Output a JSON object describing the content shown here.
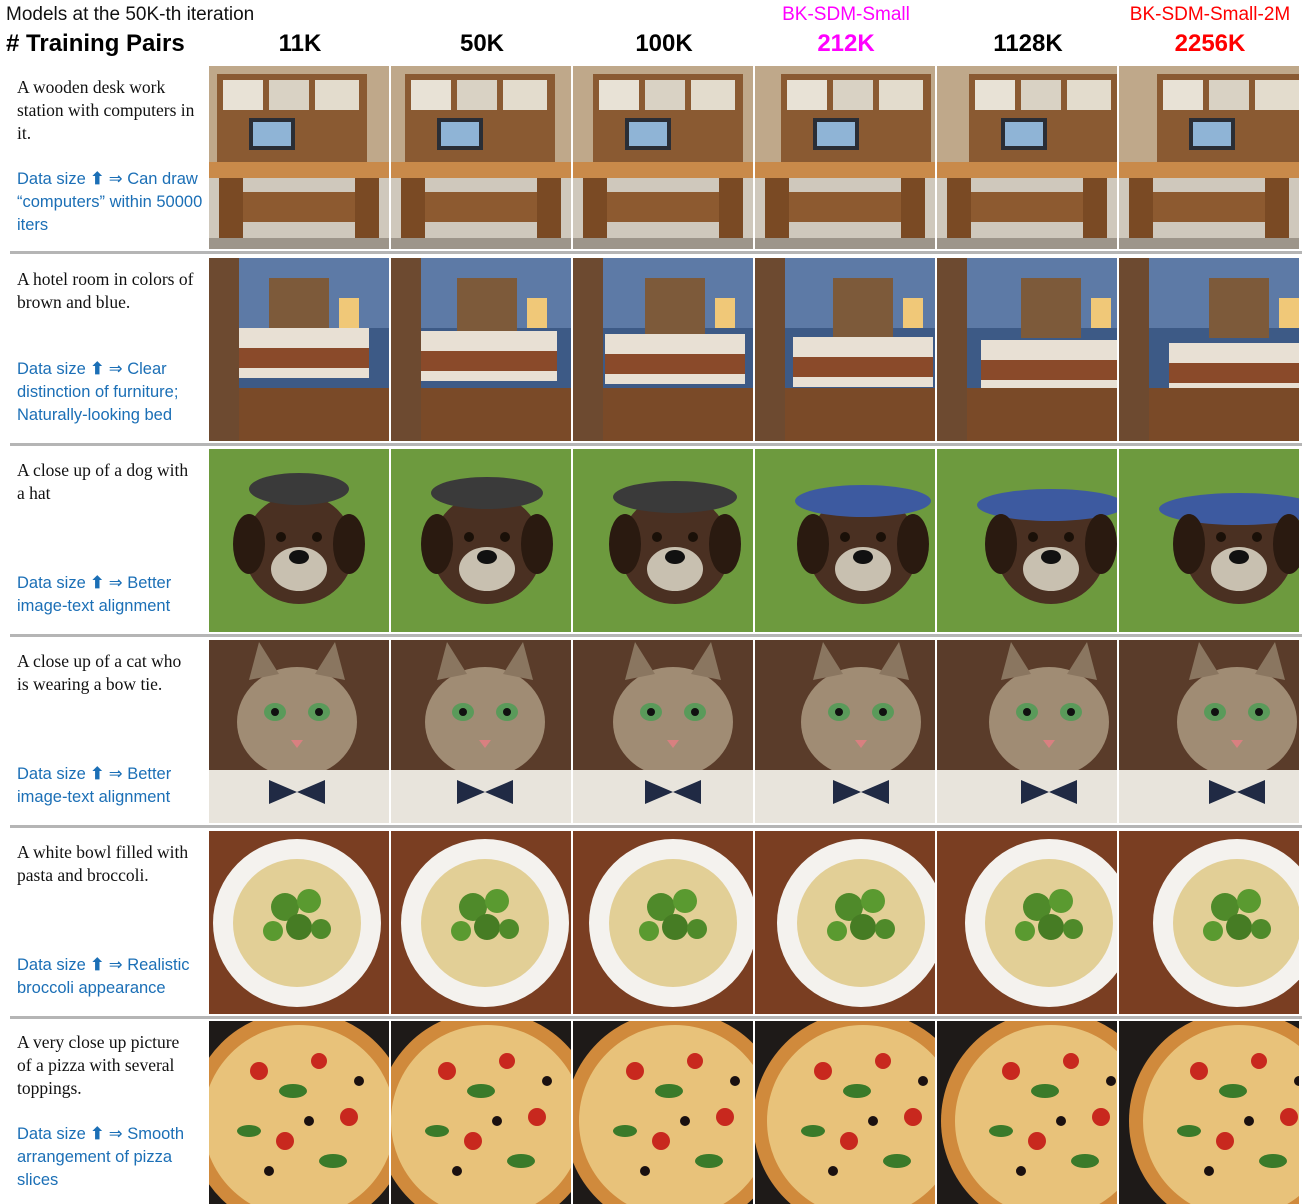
{
  "header": {
    "title": "Models at the 50K-th iteration",
    "row_label": "# Training Pairs",
    "columns": [
      {
        "name": "",
        "pairs": "11K",
        "color": "#000000"
      },
      {
        "name": "",
        "pairs": "50K",
        "color": "#000000"
      },
      {
        "name": "",
        "pairs": "100K",
        "color": "#000000"
      },
      {
        "name": "BK-SDM-Small",
        "pairs": "212K",
        "color": "#ff00ff"
      },
      {
        "name": "",
        "pairs": "1128K",
        "color": "#000000"
      },
      {
        "name": "BK-SDM-Small-2M",
        "pairs": "2256K",
        "color": "#ff0000"
      }
    ]
  },
  "rows": [
    {
      "prompt": "A wooden desk work station with computers in it.",
      "note_prefix": "Data size",
      "arrow": "⬆",
      "note_rest": "⇒ Can draw “computers” within 50000 iters",
      "scene": "desk"
    },
    {
      "prompt": "A hotel room in colors of brown and blue.",
      "note_prefix": "Data size",
      "arrow": "⬆",
      "note_rest": "⇒ Clear distinction of furniture; Naturally-looking bed",
      "scene": "hotel"
    },
    {
      "prompt": "A close up of a dog with a hat",
      "note_prefix": "Data size",
      "arrow": "⬆",
      "note_rest": "⇒ Better image-text alignment",
      "scene": "dog"
    },
    {
      "prompt": "A close up of a cat who is wearing a bow tie.",
      "note_prefix": "Data size",
      "arrow": "⬆",
      "note_rest": "⇒ Better image-text alignment",
      "scene": "cat"
    },
    {
      "prompt": "A white bowl filled with pasta and broccoli.",
      "note_prefix": "Data size",
      "arrow": "⬆",
      "note_rest": "⇒ Realistic broccoli appearance",
      "scene": "pasta"
    },
    {
      "prompt": "A very close up picture of a pizza with several toppings.",
      "note_prefix": "Data size",
      "arrow": "⬆",
      "note_rest": "⇒ Smooth arrangement of pizza slices",
      "scene": "pizza"
    }
  ]
}
